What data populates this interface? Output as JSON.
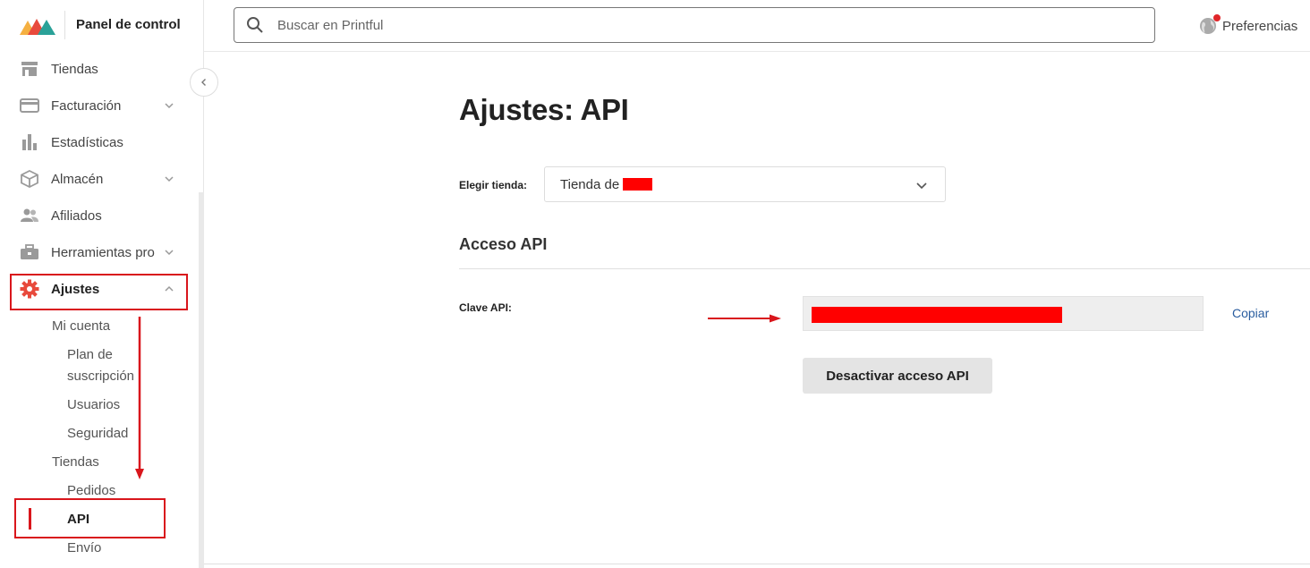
{
  "brand": {
    "title": "Panel de control",
    "logo_colors": [
      "#f5b041",
      "#e84a3c",
      "#2aa198"
    ]
  },
  "search": {
    "placeholder": "Buscar en Printful"
  },
  "header": {
    "preferences_label": "Preferencias"
  },
  "sidebar": {
    "items": [
      {
        "label": "Tiendas"
      },
      {
        "label": "Facturación"
      },
      {
        "label": "Estadísticas"
      },
      {
        "label": "Almacén"
      },
      {
        "label": "Afiliados"
      },
      {
        "label": "Herramientas pro"
      },
      {
        "label": "Ajustes"
      }
    ],
    "submenu": {
      "my_account": "Mi cuenta",
      "plan_line1": "Plan de",
      "plan_line2": "suscripción",
      "users": "Usuarios",
      "security": "Seguridad",
      "stores": "Tiendas",
      "orders": "Pedidos",
      "api": "API",
      "shipping": "Envío"
    }
  },
  "main": {
    "title": "Ajustes: API",
    "store_label": "Elegir tienda:",
    "store_value": "Tienda de",
    "section_title": "Acceso API",
    "key_label": "Clave API:",
    "copy_label": "Copiar",
    "deactivate_label": "Desactivar acceso API"
  },
  "colors": {
    "accent_red": "#d9161c",
    "redaction": "#ff0000",
    "link": "#2a5d9f",
    "active_icon": "#e84a3c"
  }
}
